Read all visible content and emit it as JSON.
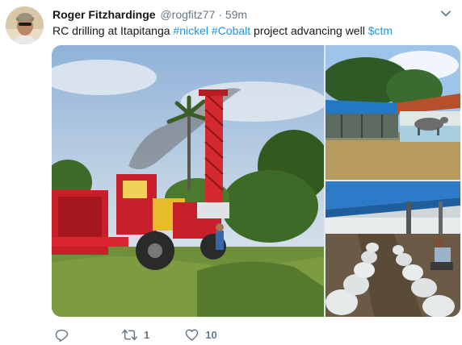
{
  "user": {
    "display_name": "Roger Fitzhardinge",
    "handle": "@rogfitz77",
    "separator": "·",
    "timestamp": "59m"
  },
  "tweet": {
    "text_before": "RC drilling at Itapitanga ",
    "hashtag_1": "#nickel",
    "hashtag_2": "#Cobalt",
    "text_middle": " project advancing well ",
    "cashtag": "$ctm"
  },
  "media": {
    "count": 3
  },
  "actions": {
    "reply": {
      "icon": "reply-icon",
      "count": ""
    },
    "retweet": {
      "icon": "retweet-icon",
      "count": "1"
    },
    "like": {
      "icon": "heart-icon",
      "count": "10"
    }
  },
  "colors": {
    "link": "#1b95e0",
    "secondary_text": "#657786",
    "primary_text": "#14171a",
    "rig_red": "#c8202a"
  },
  "icons": {
    "menu": "chevron-down-icon"
  }
}
